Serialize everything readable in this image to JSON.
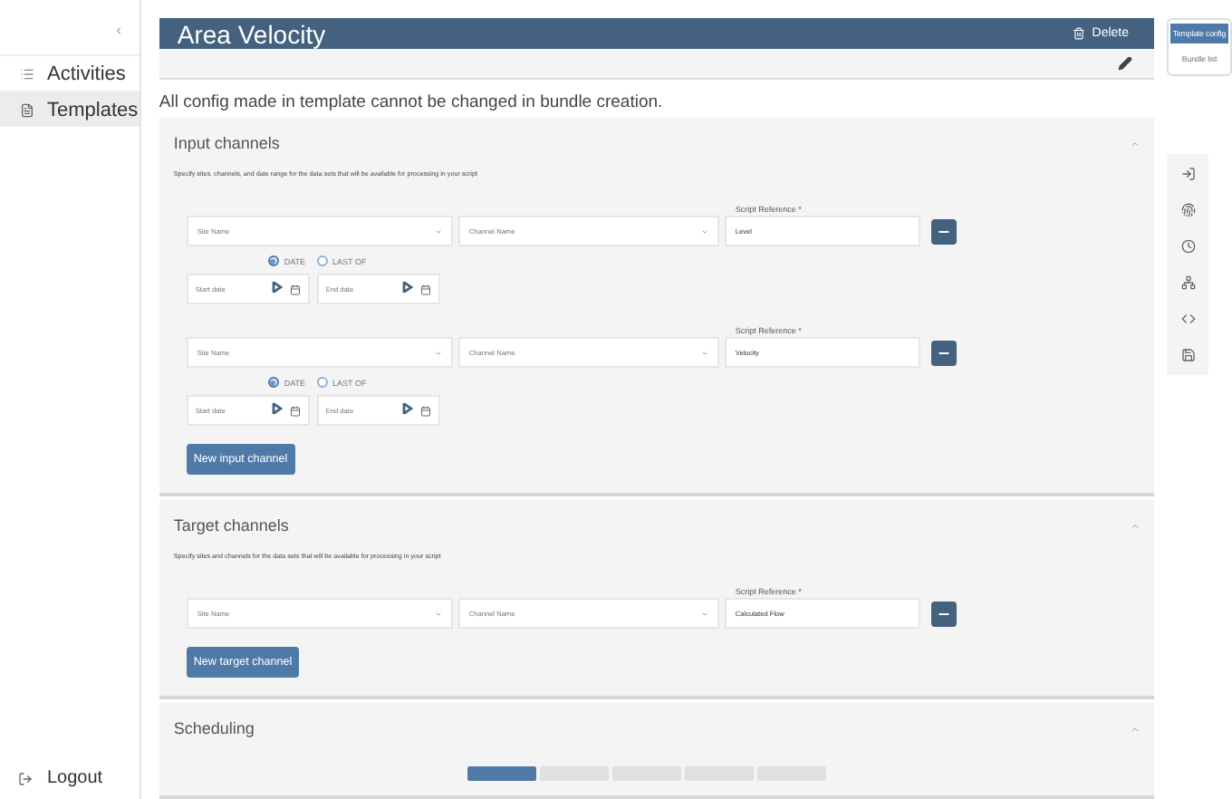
{
  "sidebar": {
    "collapse": "‹",
    "items": [
      {
        "label": "Activities",
        "selected": false
      },
      {
        "label": "Templates",
        "selected": true
      }
    ],
    "logout": "Logout"
  },
  "header": {
    "title": "Area Velocity",
    "delete": "Delete"
  },
  "notice": "All config made in template cannot be changed in bundle creation.",
  "right_tabs": [
    {
      "label": "Template config",
      "selected": true
    },
    {
      "label": "Bundle list",
      "selected": false
    }
  ],
  "sections": [
    {
      "kind": "channels",
      "title": "Input channels",
      "expanded": true,
      "description": "Specify sites, channels, and date range for the data sets that will be available for processing in your script",
      "channels": [
        {
          "site_placeholder": "Site Name",
          "channel_placeholder": "Channel Name",
          "reference_label": "Script Reference *",
          "reference": "Level",
          "range": {
            "options": [
              {
                "label": "DATE",
                "selected": true
              },
              {
                "label": "LAST OF",
                "selected": false
              }
            ],
            "start_placeholder": "Start date",
            "end_placeholder": "End date"
          }
        },
        {
          "site_placeholder": "Site Name",
          "channel_placeholder": "Channel Name",
          "reference_label": "Script Reference *",
          "reference": "Velocity",
          "range": {
            "options": [
              {
                "label": "DATE",
                "selected": true
              },
              {
                "label": "LAST OF",
                "selected": false
              }
            ],
            "start_placeholder": "Start date",
            "end_placeholder": "End date"
          }
        }
      ],
      "add_button": "New input channel"
    },
    {
      "kind": "channels",
      "title": "Target channels",
      "expanded": true,
      "description": "Specify sites and channels for the data sets that will be available for processing in your script",
      "channels": [
        {
          "site_placeholder": "Site Name",
          "channel_placeholder": "Channel Name",
          "reference_label": "Script Reference *",
          "reference": "Calculated Flow"
        }
      ],
      "add_button": "New target channel"
    },
    {
      "kind": "scheduling",
      "title": "Scheduling",
      "expanded": true,
      "tabs": [
        {
          "selected": true
        },
        {
          "selected": false
        },
        {
          "selected": false
        },
        {
          "selected": false
        },
        {
          "selected": false
        }
      ]
    }
  ]
}
